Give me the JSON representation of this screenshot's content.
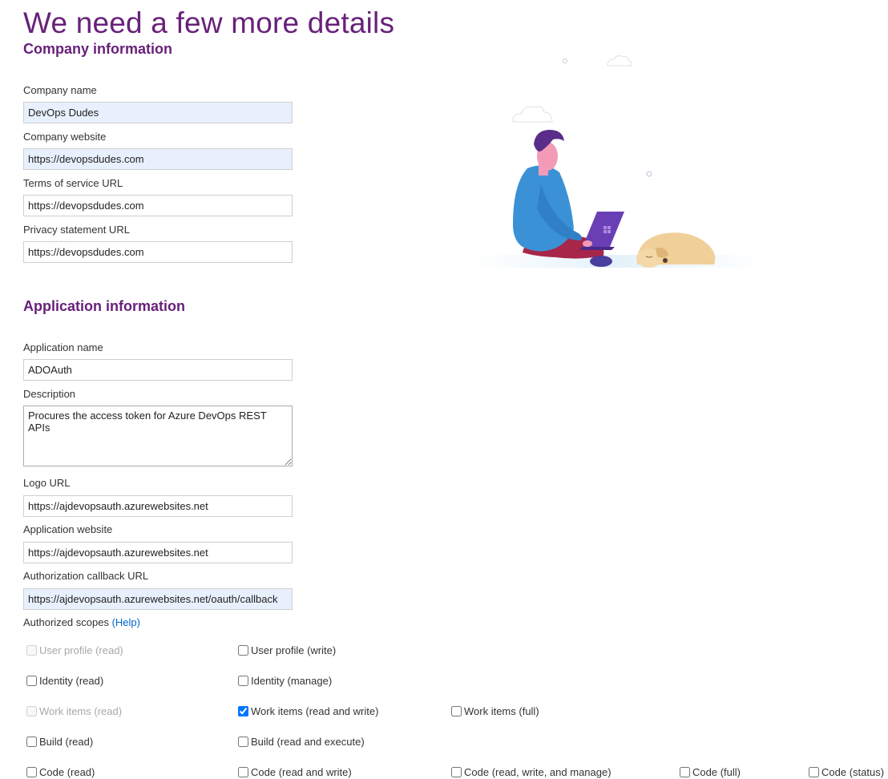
{
  "page_title": "We need a few more details",
  "company": {
    "heading": "Company information",
    "fields": {
      "name": {
        "label": "Company name",
        "value": "DevOps Dudes"
      },
      "website": {
        "label": "Company website",
        "value": "https://devopsdudes.com"
      },
      "tos": {
        "label": "Terms of service URL",
        "value": "https://devopsdudes.com"
      },
      "privacy": {
        "label": "Privacy statement URL",
        "value": "https://devopsdudes.com"
      }
    }
  },
  "application": {
    "heading": "Application information",
    "fields": {
      "name": {
        "label": "Application name",
        "value": "ADOAuth"
      },
      "description": {
        "label": "Description",
        "value": "Procures the access token for Azure DevOps REST APIs"
      },
      "logo": {
        "label": "Logo URL",
        "value": "https://ajdevopsauth.azurewebsites.net"
      },
      "website": {
        "label": "Application website",
        "value": "https://ajdevopsauth.azurewebsites.net"
      },
      "callback": {
        "label": "Authorization callback URL",
        "value": "https://ajdevopsauth.azurewebsites.net/oauth/callback"
      }
    },
    "scopes_label": "Authorized scopes",
    "help_link": "(Help)",
    "scopes": {
      "user_profile_read": {
        "label": "User profile (read)",
        "checked": false,
        "disabled": true
      },
      "user_profile_write": {
        "label": "User profile (write)",
        "checked": false,
        "disabled": false
      },
      "identity_read": {
        "label": "Identity (read)",
        "checked": false,
        "disabled": false
      },
      "identity_manage": {
        "label": "Identity (manage)",
        "checked": false,
        "disabled": false
      },
      "work_items_read": {
        "label": "Work items (read)",
        "checked": false,
        "disabled": true
      },
      "work_items_read_write": {
        "label": "Work items (read and write)",
        "checked": true,
        "disabled": false
      },
      "work_items_full": {
        "label": "Work items (full)",
        "checked": false,
        "disabled": false
      },
      "build_read": {
        "label": "Build (read)",
        "checked": false,
        "disabled": false
      },
      "build_read_execute": {
        "label": "Build (read and execute)",
        "checked": false,
        "disabled": false
      },
      "code_read": {
        "label": "Code (read)",
        "checked": false,
        "disabled": false
      },
      "code_read_write": {
        "label": "Code (read and write)",
        "checked": false,
        "disabled": false
      },
      "code_read_write_manage": {
        "label": "Code (read, write, and manage)",
        "checked": false,
        "disabled": false
      },
      "code_full": {
        "label": "Code (full)",
        "checked": false,
        "disabled": false
      },
      "code_status": {
        "label": "Code (status)",
        "checked": false,
        "disabled": false
      }
    }
  },
  "colors": {
    "accent": "#68217a",
    "link": "#0066cc",
    "autofill": "#e8f0fe"
  },
  "illustration": {
    "icons": [
      "person-with-laptop-icon",
      "sleeping-dog-icon",
      "cloud-icon"
    ]
  }
}
